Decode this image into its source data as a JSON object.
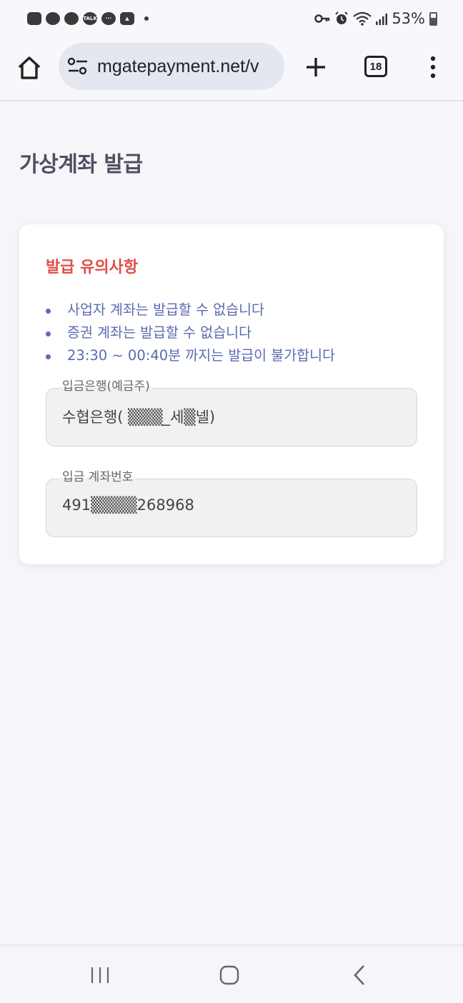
{
  "status_bar": {
    "notifications": [
      "kakaotalk-icon",
      "kakaotalk-icon",
      "kakaotalk-icon",
      "talk-icon",
      "chat-icon",
      "image-icon"
    ],
    "talk_badge": "TALK",
    "battery_percent": "53%",
    "battery_level": 0.53
  },
  "browser": {
    "url": "mgatepayment.net/v",
    "tab_count": "18"
  },
  "page": {
    "title": "가상계좌 발급"
  },
  "notice": {
    "title": "발급 유의사항",
    "items": [
      "사업자 계좌는 발급할 수 없습니다",
      "증권 계좌는 발급할 수 없습니다",
      "23:30 ~ 00:40분 까지는 발급이 불가합니다"
    ]
  },
  "fields": {
    "bank": {
      "label": "입금은행(예금주)",
      "value": "수협은행(  ▒▒▒_세▒넬)"
    },
    "account": {
      "label": "입금 계좌번호",
      "value": "491▒▒▒▒268968"
    }
  },
  "colors": {
    "accent_red": "#e24c48",
    "notice_blue": "#5b6bb0",
    "title_gray": "#4e5060"
  }
}
